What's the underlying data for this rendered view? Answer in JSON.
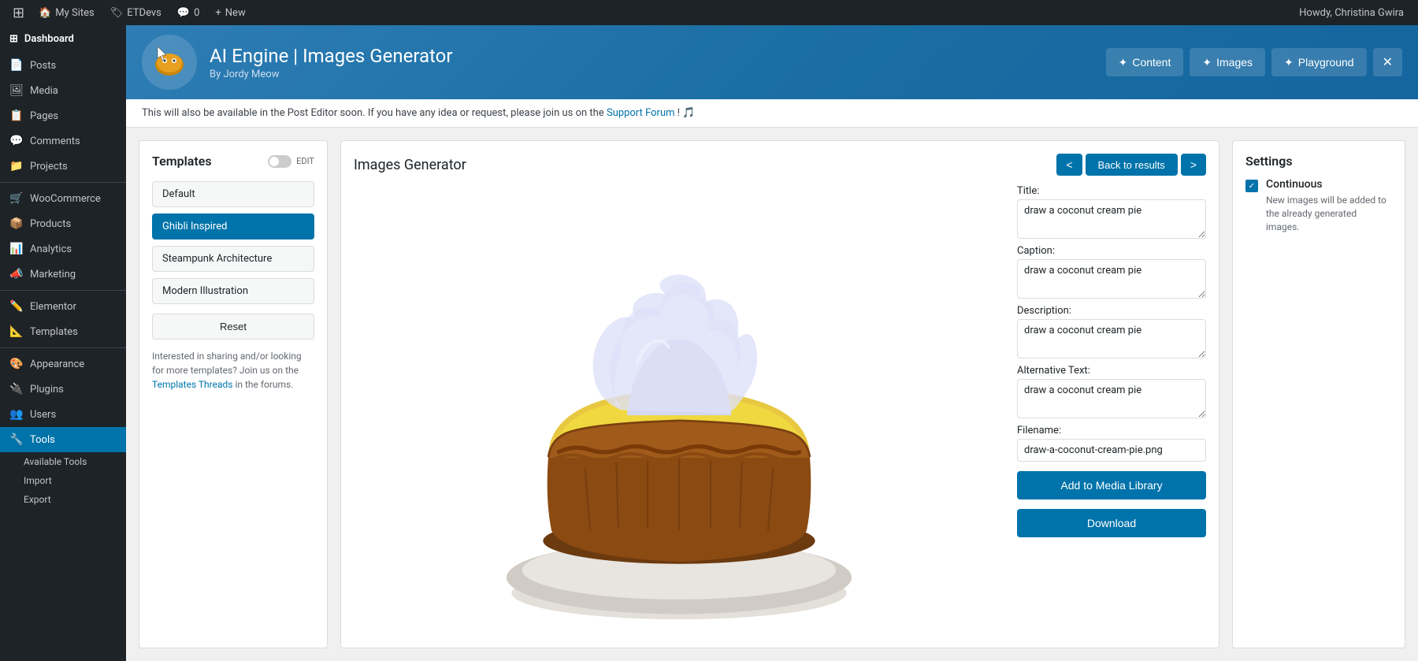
{
  "adminbar": {
    "logo": "⊞",
    "items": [
      {
        "label": "My Sites",
        "icon": "🏠"
      },
      {
        "label": "ETDevs",
        "icon": "🏷"
      },
      {
        "label": "0",
        "icon": "💬"
      },
      {
        "label": "New",
        "icon": "+"
      }
    ],
    "user": "Howdy, Christina Gwira"
  },
  "sidebar": {
    "dashboard": "Dashboard",
    "items": [
      {
        "id": "posts",
        "label": "Posts",
        "icon": "📄"
      },
      {
        "id": "media",
        "label": "Media",
        "icon": "🖼"
      },
      {
        "id": "pages",
        "label": "Pages",
        "icon": "📋"
      },
      {
        "id": "comments",
        "label": "Comments",
        "icon": "💬"
      },
      {
        "id": "projects",
        "label": "Projects",
        "icon": "📁"
      },
      {
        "id": "woocommerce",
        "label": "WooCommerce",
        "icon": "🛒"
      },
      {
        "id": "products",
        "label": "Products",
        "icon": "📦"
      },
      {
        "id": "analytics",
        "label": "Analytics",
        "icon": "📊"
      },
      {
        "id": "marketing",
        "label": "Marketing",
        "icon": "📣"
      },
      {
        "id": "elementor",
        "label": "Elementor",
        "icon": "✏️"
      },
      {
        "id": "templates",
        "label": "Templates",
        "icon": "📐"
      },
      {
        "id": "appearance",
        "label": "Appearance",
        "icon": "🎨"
      },
      {
        "id": "plugins",
        "label": "Plugins",
        "icon": "🔌"
      },
      {
        "id": "users",
        "label": "Users",
        "icon": "👥"
      },
      {
        "id": "tools",
        "label": "Tools",
        "icon": "🔧"
      }
    ],
    "subItems": [
      {
        "id": "available-tools",
        "label": "Available Tools"
      },
      {
        "id": "import",
        "label": "Import"
      },
      {
        "id": "export",
        "label": "Export"
      }
    ]
  },
  "plugin_header": {
    "title": "AI Engine | Images Generator",
    "subtitle": "By Jordy Meow",
    "nav": {
      "content": "Content",
      "images": "Images",
      "playground": "Playground"
    },
    "sun_icon": "✦"
  },
  "notice": {
    "text": "This will also be available in the Post Editor soon. If you have any idea or request, please join us on the",
    "link_text": "Support Forum",
    "suffix": "! 🎵"
  },
  "templates": {
    "title": "Templates",
    "edit_label": "EDIT",
    "items": [
      {
        "id": "default",
        "label": "Default",
        "active": false
      },
      {
        "id": "ghibli",
        "label": "Ghibli Inspired",
        "active": true
      },
      {
        "id": "steampunk",
        "label": "Steampunk Architecture",
        "active": false
      },
      {
        "id": "modern",
        "label": "Modern Illustration",
        "active": false
      }
    ],
    "reset_label": "Reset",
    "footer_text": "Interested in sharing and/or looking for more templates? Join us on the",
    "footer_link": "Templates Threads",
    "footer_suffix": " in the forums."
  },
  "generator": {
    "title": "Images Generator",
    "back_label": "Back to results",
    "nav_prev": "<",
    "nav_next": ">",
    "fields": {
      "title_label": "Title:",
      "title_value": "draw a coconut cream pie",
      "caption_label": "Caption:",
      "caption_value": "draw a coconut cream pie",
      "description_label": "Description:",
      "description_value": "draw a coconut cream pie",
      "alt_label": "Alternative Text:",
      "alt_value": "draw a coconut cream pie",
      "filename_label": "Filename:",
      "filename_value": "draw-a-coconut-cream-pie.png"
    },
    "add_to_media_label": "Add to Media Library",
    "download_label": "Download"
  },
  "settings": {
    "title": "Settings",
    "continuous_label": "Continuous",
    "continuous_desc": "New images will be added to the already generated images.",
    "checkbox_checked": true
  }
}
